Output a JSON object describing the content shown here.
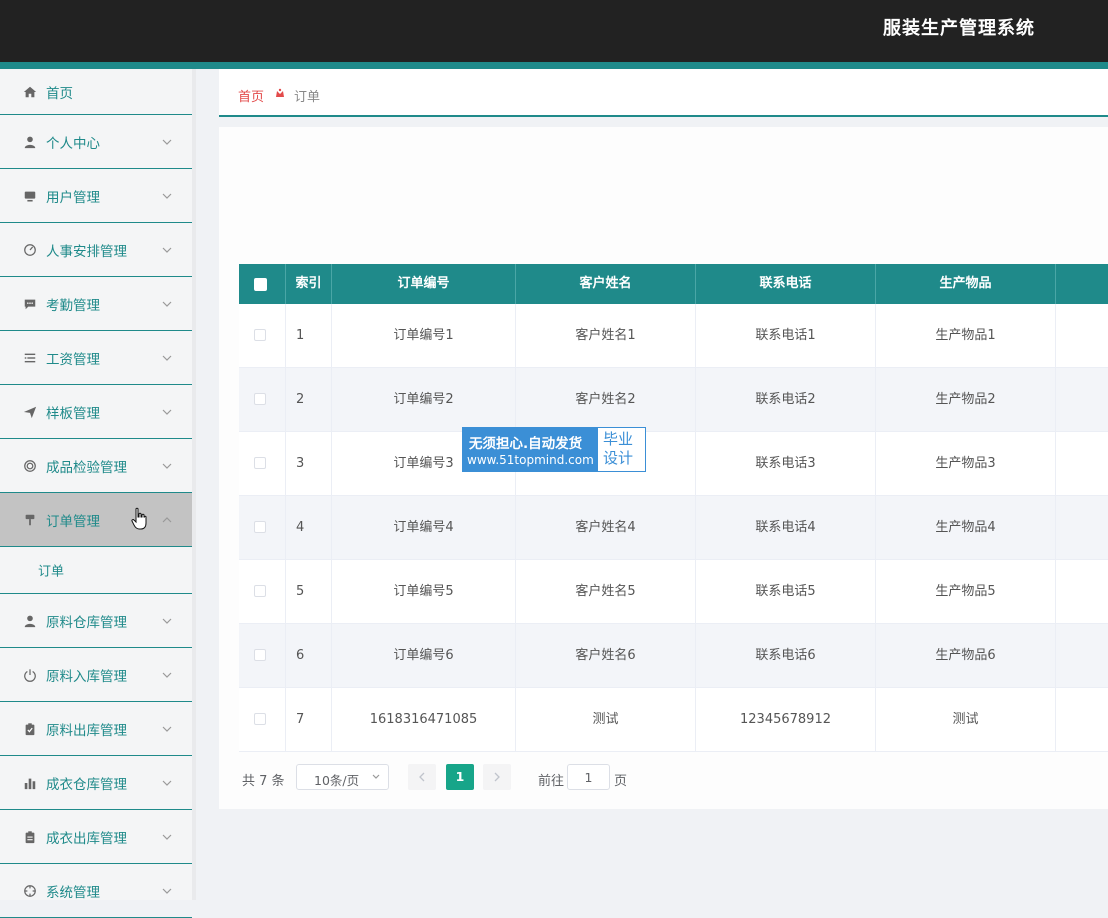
{
  "app": {
    "title": "服装生产管理系统"
  },
  "sidebar": {
    "items": [
      {
        "label": "首页",
        "icon": "home-icon",
        "expandable": false
      },
      {
        "label": "个人中心",
        "icon": "user-icon",
        "expandable": true
      },
      {
        "label": "用户管理",
        "icon": "monitor-icon",
        "expandable": true
      },
      {
        "label": "人事安排管理",
        "icon": "gauge-icon",
        "expandable": true
      },
      {
        "label": "考勤管理",
        "icon": "chat-icon",
        "expandable": true
      },
      {
        "label": "工资管理",
        "icon": "list-icon",
        "expandable": true
      },
      {
        "label": "样板管理",
        "icon": "send-icon",
        "expandable": true
      },
      {
        "label": "成品检验管理",
        "icon": "target-icon",
        "expandable": true
      },
      {
        "label": "订单管理",
        "icon": "pin-icon",
        "expandable": true,
        "expanded": true,
        "submenu": [
          "订单"
        ]
      },
      {
        "label": "原料仓库管理",
        "icon": "person-icon",
        "expandable": true
      },
      {
        "label": "原料入库管理",
        "icon": "power-icon",
        "expandable": true
      },
      {
        "label": "原料出库管理",
        "icon": "clipboard-check-icon",
        "expandable": true
      },
      {
        "label": "成衣仓库管理",
        "icon": "bar-chart-icon",
        "expandable": true
      },
      {
        "label": "成衣出库管理",
        "icon": "clipboard-icon",
        "expandable": true
      },
      {
        "label": "系统管理",
        "icon": "crosshair-icon",
        "expandable": true
      }
    ]
  },
  "breadcrumb": {
    "home": "首页",
    "current": "订单"
  },
  "table": {
    "columns": [
      "索引",
      "订单编号",
      "客户姓名",
      "联系电话",
      "生产物品"
    ],
    "rows": [
      [
        "1",
        "订单编号1",
        "客户姓名1",
        "联系电话1",
        "生产物品1"
      ],
      [
        "2",
        "订单编号2",
        "客户姓名2",
        "联系电话2",
        "生产物品2"
      ],
      [
        "3",
        "订单编号3",
        "",
        "联系电话3",
        "生产物品3"
      ],
      [
        "4",
        "订单编号4",
        "客户姓名4",
        "联系电话4",
        "生产物品4"
      ],
      [
        "5",
        "订单编号5",
        "客户姓名5",
        "联系电话5",
        "生产物品5"
      ],
      [
        "6",
        "订单编号6",
        "客户姓名6",
        "联系电话6",
        "生产物品6"
      ],
      [
        "7",
        "1618316471085",
        "测试",
        "12345678912",
        "测试"
      ]
    ]
  },
  "pagination": {
    "total": "共 7 条",
    "page_size": "10条/页",
    "current_page": "1",
    "goto_prefix": "前往",
    "goto_value": "1",
    "goto_suffix": "页"
  },
  "watermark": {
    "line1": "无须担心.自动发货",
    "line2": "www.51topmind.com",
    "right1": "毕业",
    "right2": "设计"
  },
  "colors": {
    "accent": "#1f8a8a",
    "topbar": "#222222",
    "breadcrumb_home": "#e34b4b",
    "page_active": "#17a589",
    "watermark": "#3b8fd6"
  }
}
